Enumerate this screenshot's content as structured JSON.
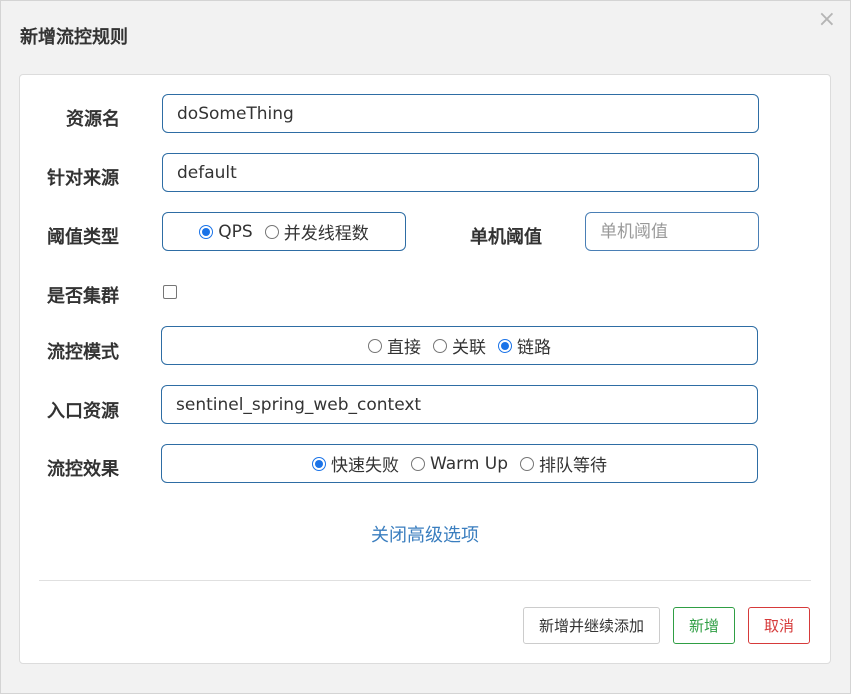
{
  "dialog": {
    "title": "新增流控规则",
    "close_glyph": "×"
  },
  "form": {
    "resource_name": {
      "label": "资源名",
      "value": "doSomeThing"
    },
    "limit_app": {
      "label": "针对来源",
      "value": "default"
    },
    "grade": {
      "label": "阈值类型",
      "options": [
        {
          "label": "QPS",
          "checked": true
        },
        {
          "label": "并发线程数",
          "checked": false
        }
      ]
    },
    "count": {
      "label": "单机阈值",
      "value": "",
      "placeholder": "单机阈值"
    },
    "cluster": {
      "label": "是否集群",
      "checked": false
    },
    "strategy": {
      "label": "流控模式",
      "options": [
        {
          "label": "直接",
          "checked": false
        },
        {
          "label": "关联",
          "checked": false
        },
        {
          "label": "链路",
          "checked": true
        }
      ]
    },
    "ref_resource": {
      "label": "入口资源",
      "value": "sentinel_spring_web_context"
    },
    "control_behavior": {
      "label": "流控效果",
      "options": [
        {
          "label": "快速失败",
          "checked": true
        },
        {
          "label": "Warm Up",
          "checked": false
        },
        {
          "label": "排队等待",
          "checked": false
        }
      ]
    },
    "advanced_toggle": "关闭高级选项"
  },
  "footer": {
    "add_continue_label": "新增并继续添加",
    "add_label": "新增",
    "cancel_label": "取消"
  }
}
